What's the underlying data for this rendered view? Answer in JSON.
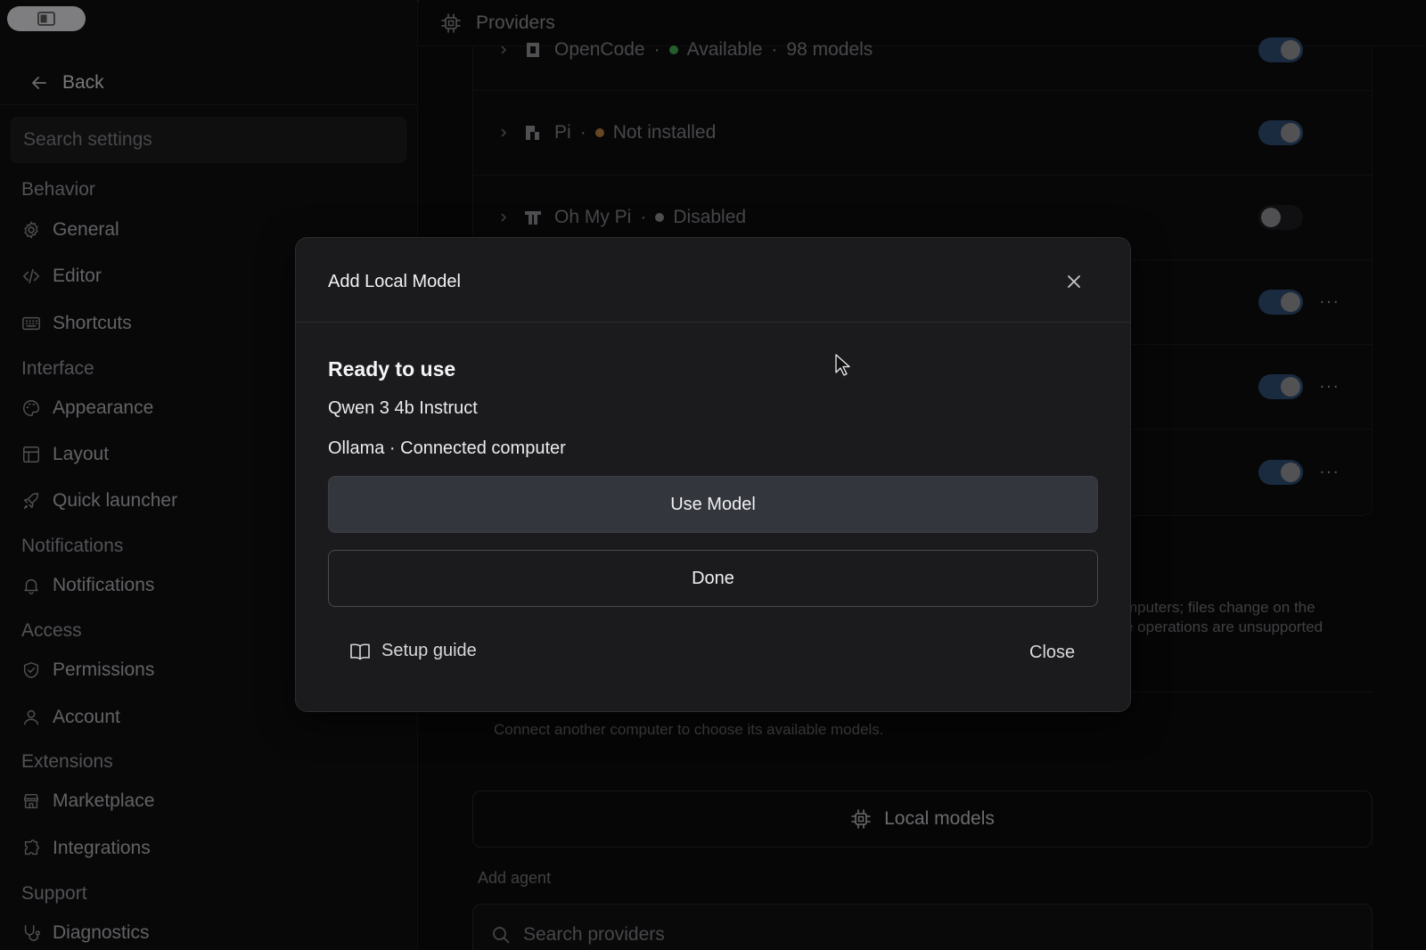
{
  "window": {
    "button_icon": "window-icon"
  },
  "sidebar": {
    "back_label": "Back",
    "search_placeholder": "Search settings",
    "sections": {
      "behavior": "Behavior",
      "interface": "Interface",
      "notifications": "Notifications",
      "access": "Access",
      "extensions": "Extensions",
      "support": "Support"
    },
    "items": {
      "general": "General",
      "editor": "Editor",
      "shortcuts": "Shortcuts",
      "appearance": "Appearance",
      "layout": "Layout",
      "quick_launcher": "Quick launcher",
      "notifications": "Notifications",
      "permissions": "Permissions",
      "account": "Account",
      "marketplace": "Marketplace",
      "integrations": "Integrations",
      "diagnostics": "Diagnostics"
    }
  },
  "header": {
    "title": "Providers"
  },
  "providers": [
    {
      "name": "OpenCode",
      "status": "Available",
      "models": "98 models",
      "status_color": "#3fa34d",
      "enabled": true
    },
    {
      "name": "Pi",
      "status": "Not installed",
      "status_color": "#b07a3e",
      "enabled": true
    },
    {
      "name": "Oh My Pi",
      "status": "Disabled",
      "status_color": "#8a8a8f",
      "enabled": false
    }
  ],
  "separator": "·",
  "more_label": "···",
  "background": {
    "note_line1": "mputers; files change on the",
    "note_line2": "e operations are unsupported",
    "connect_note": "Connect another computer to choose its available models.",
    "local_models_label": "Local models",
    "add_agent_label": "Add agent",
    "search_providers_placeholder": "Search providers"
  },
  "modal": {
    "title": "Add Local Model",
    "ready": "Ready to use",
    "model_name": "Qwen 3 4b Instruct",
    "model_source": "Ollama · Connected computer",
    "use_button": "Use Model",
    "done_button": "Done",
    "guide_label": "Setup guide",
    "close_label": "Close"
  },
  "colors": {
    "accent_toggle": "#2d4a6e",
    "background": "#0b0b0c",
    "modal": "#1b1b1d"
  }
}
